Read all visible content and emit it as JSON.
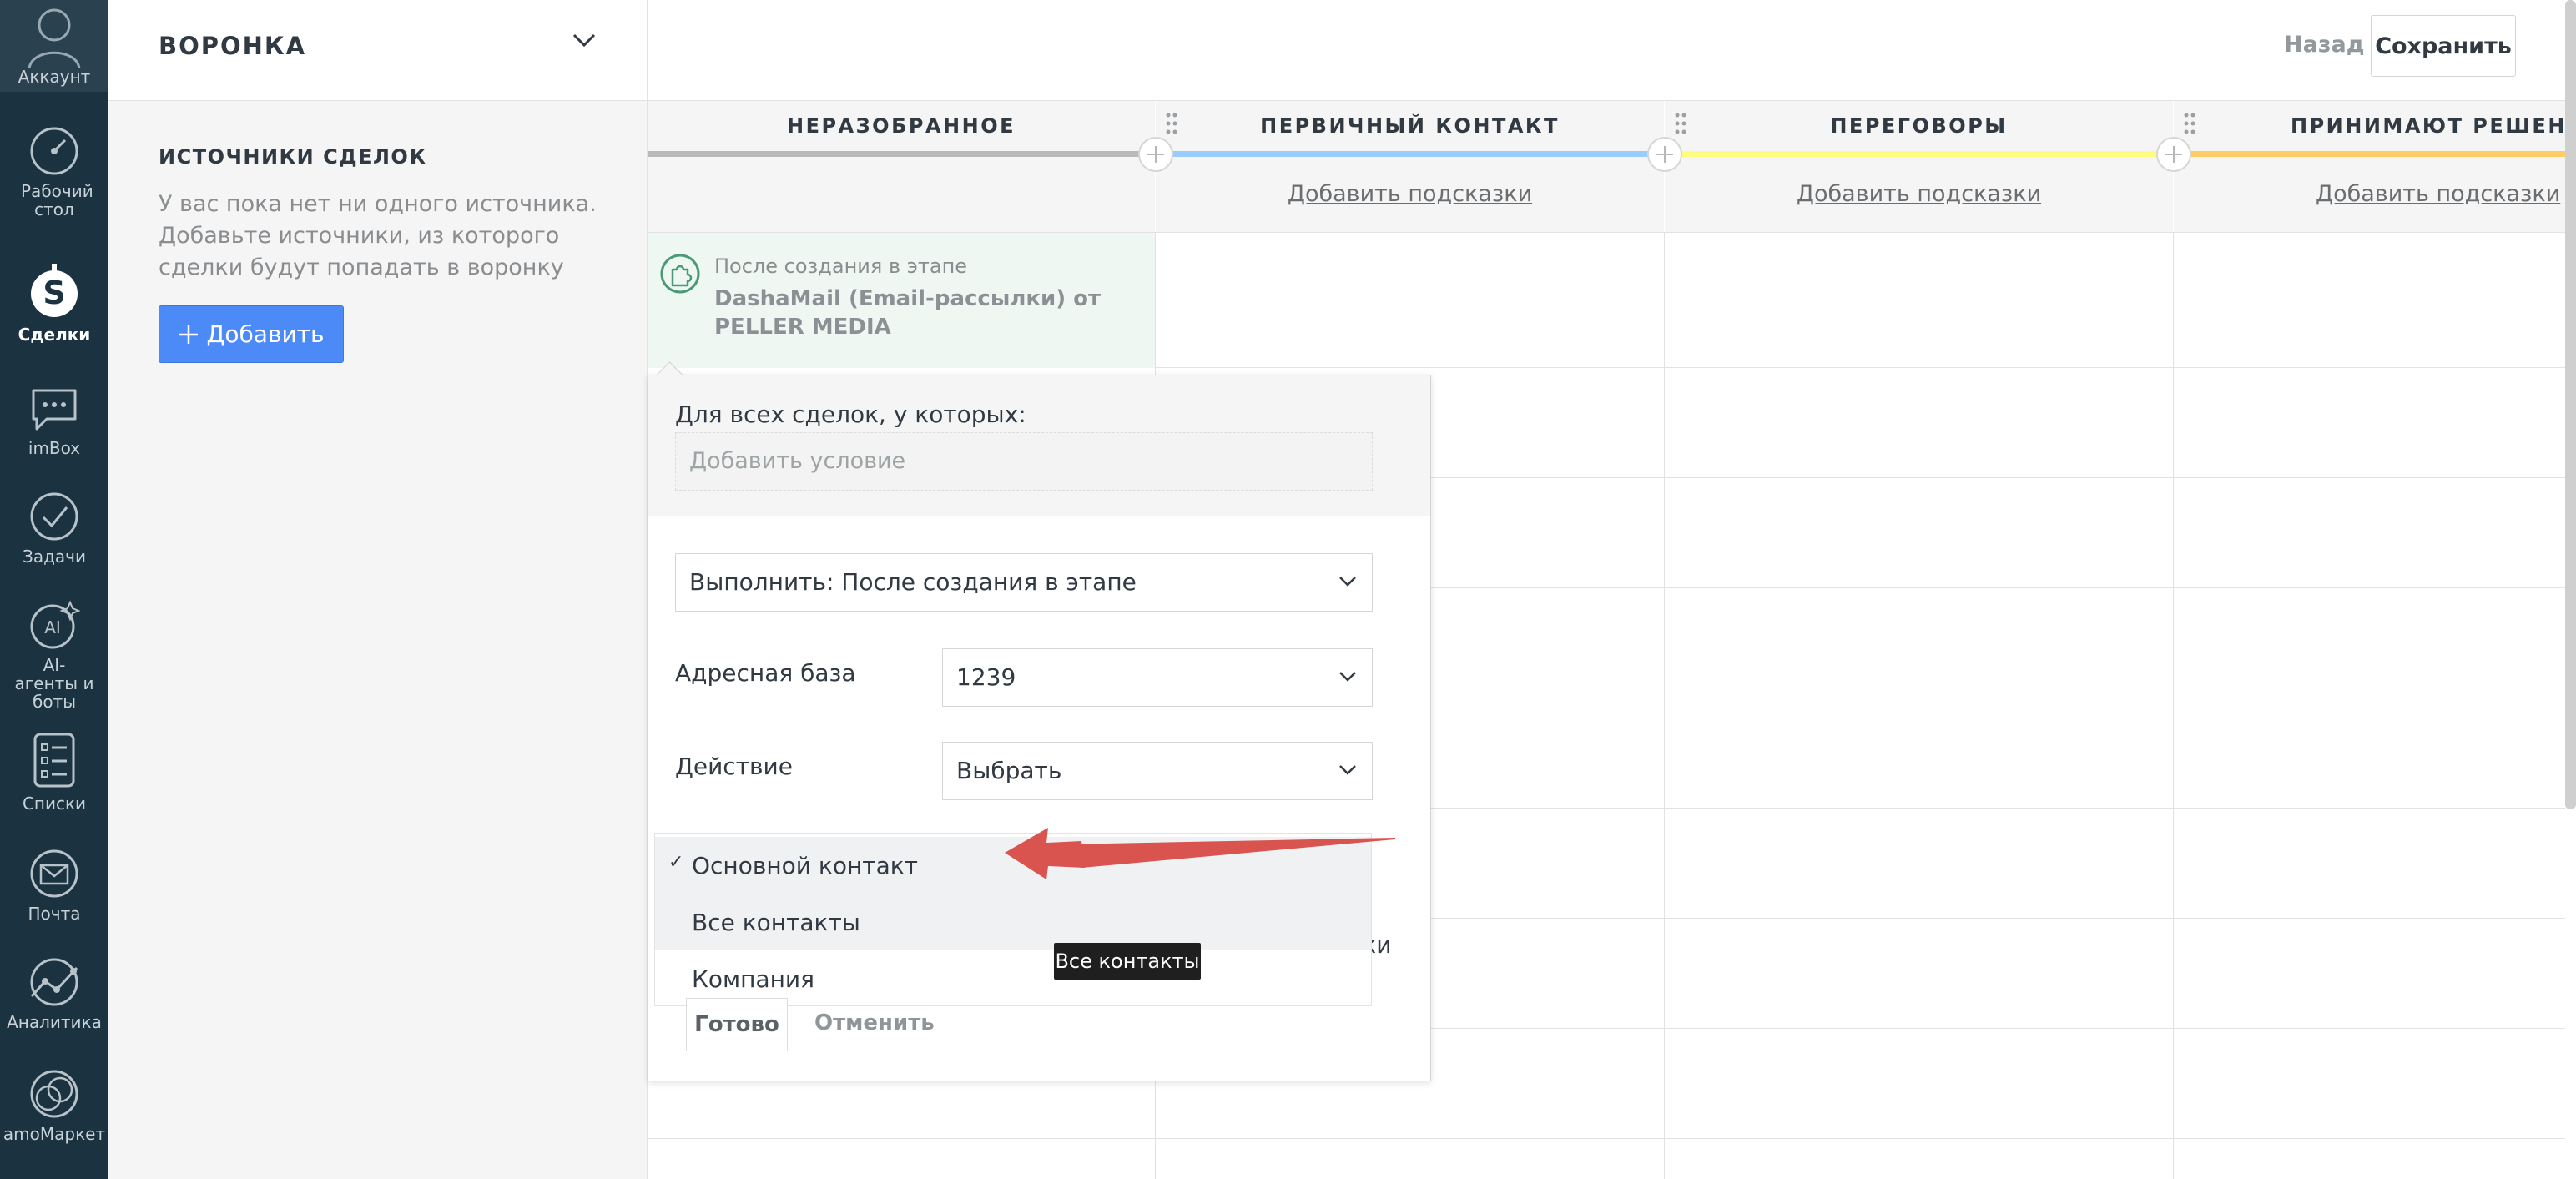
{
  "nav": {
    "items": [
      {
        "id": "account",
        "label": "Аккаунт",
        "icon": "avatar-icon"
      },
      {
        "id": "dashboard",
        "label": "Рабочий стол",
        "icon": "speedometer-icon"
      },
      {
        "id": "deals",
        "label": "Сделки",
        "icon": "dollar-icon",
        "active": true
      },
      {
        "id": "imbox",
        "label": "imBox",
        "icon": "chat-icon"
      },
      {
        "id": "tasks",
        "label": "Задачи",
        "icon": "checkmark-icon"
      },
      {
        "id": "ai",
        "label": "AI-агенты и боты",
        "icon": "ai-bot-icon"
      },
      {
        "id": "lists",
        "label": "Списки",
        "icon": "list-icon"
      },
      {
        "id": "mail",
        "label": "Почта",
        "icon": "envelope-icon"
      },
      {
        "id": "analytics",
        "label": "Аналитика",
        "icon": "chart-line-icon"
      },
      {
        "id": "market",
        "label": "amoМаркет",
        "icon": "market-icon"
      }
    ]
  },
  "sidebar": {
    "title": "ВОРОНКА",
    "sources_title": "ИСТОЧНИКИ СДЕЛОК",
    "sources_text": "У вас пока нет ни одного источника. Добавьте источники, из которого сделки будут попадать в воронку",
    "add_button": "Добавить"
  },
  "topbar": {
    "back": "Назад",
    "save": "Сохранить"
  },
  "columns": [
    {
      "name": "НЕРАЗОБРАННОЕ",
      "color": "#b9b9b9",
      "hint": ""
    },
    {
      "name": "ПЕРВИЧНЫЙ КОНТАКТ",
      "color": "#99ccff",
      "hint": "Добавить подсказки"
    },
    {
      "name": "ПЕРЕГОВОРЫ",
      "color": "#fffd7f",
      "hint": "Добавить подсказки"
    },
    {
      "name": "ПРИНИМАЮТ РЕШЕНИЕ",
      "color": "#ffcc66",
      "hint": "Добавить подсказки"
    }
  ],
  "source_card": {
    "subtitle": "После создания в этапе",
    "name": "DashaMail (Email-рассылки) от PELLER MEDIA"
  },
  "popup": {
    "condition_title": "Для всех сделок, у которых:",
    "condition_placeholder": "Добавить условие",
    "execute_value": "Выполнить: После создания в этапе",
    "address_label": "Адресная база",
    "address_value": "1239",
    "action_label": "Действие",
    "action_value": "Выбрать",
    "dropdown_options": [
      {
        "label": "Основной контакт",
        "checked": true
      },
      {
        "label": "Все контакты",
        "checked": false
      },
      {
        "label": "Компания",
        "checked": false
      }
    ],
    "peek_text": "нки",
    "tooltip": "Все контакты",
    "done": "Готово",
    "cancel": "Отменить"
  },
  "colors": {
    "nav_bg": "#1b3340",
    "accent": "#4c8bf7",
    "annotation_arrow": "#d9534f"
  }
}
